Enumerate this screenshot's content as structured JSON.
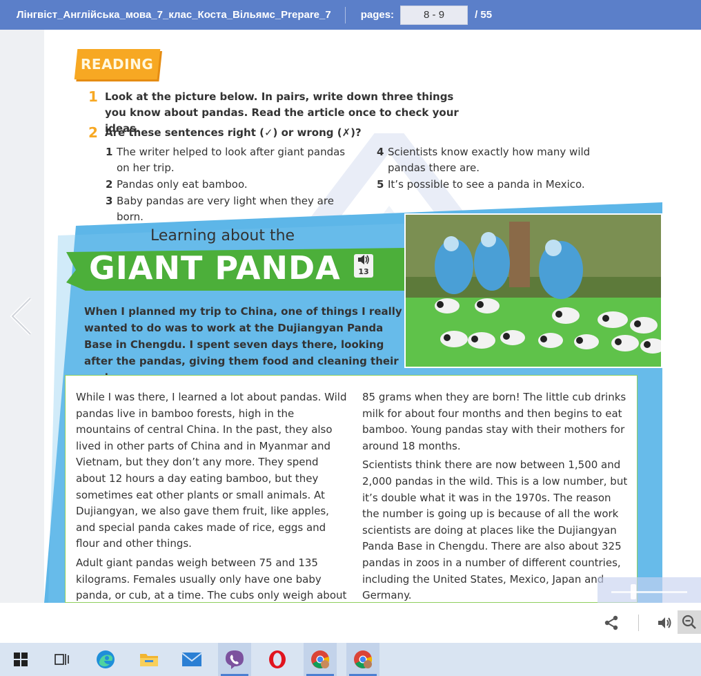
{
  "topbar": {
    "title": "Лінгвіст_Англійська_мова_7_клас_Коста_Вільямс_Prepare_7",
    "pages_label": "pages:",
    "pages_value": "8 - 9",
    "pages_total": "/ 55"
  },
  "page": {
    "section_tag": "READING",
    "task1": {
      "number": "1",
      "text": "Look at the picture below. In pairs, write down three things you know about pandas. Read the article once to check your ideas."
    },
    "task2": {
      "number": "2",
      "text": "Are these sentences right (✓) or wrong (✗)?"
    },
    "statements": [
      {
        "n": "1",
        "text": "The writer helped to look after giant pandas on her trip."
      },
      {
        "n": "2",
        "text": "Pandas only eat bamboo."
      },
      {
        "n": "3",
        "text": "Baby pandas are very light when they are born."
      },
      {
        "n": "4",
        "text": "Scientists know exactly how many wild pandas there are."
      },
      {
        "n": "5",
        "text": "It’s possible to see a panda in Mexico."
      }
    ],
    "article": {
      "headline_small": "Learning about the",
      "headline_big": "GIANT PANDA",
      "audio_track": "13",
      "intro": "When I planned my trip to China, one of things I really wanted to do was to work at the Dujiangyan Panda Base in Chengdu. I spent seven days there, looking after the pandas, giving them food and cleaning their enclosures.",
      "col1_p1": "While I was there, I learned a lot about pandas. Wild pandas live in bamboo forests, high in the mountains of central China. In the past, they also lived in other parts of China and in Myanmar and Vietnam, but they don’t any more. They spend about 12 hours a day eating bamboo, but they sometimes eat other plants or small animals. At Dujiangyan, we also gave them fruit, like apples, and special panda cakes made of rice, eggs and flour and other things.",
      "col1_p2": "Adult giant pandas weigh between 75 and 135 kilograms. Females usually only have one baby panda, or cub, at a time. The cubs only weigh about",
      "col2_p1": "85 grams when they are born! The little cub drinks milk for about four months and then begins to eat bamboo. Young pandas stay with their mothers for around 18 months.",
      "col2_p2": "Scientists think there are now between 1,500 and 2,000 pandas in the wild. This is a low number, but it’s double what it was in the 1970s. The reason the number is going up is because of all the work scientists are doing at places like the Dujiangyan Panda Base in Chengdu. There are also about 325 pandas in zoos in a number of different countries, including the United States, Mexico, Japan and Germany."
    }
  },
  "toolbar": {
    "icons": [
      "share-icon",
      "volume-icon",
      "zoom-out-icon"
    ]
  },
  "taskbar": {
    "apps": [
      "windows-start",
      "task-view",
      "edge",
      "file-explorer",
      "mail",
      "viber",
      "opera",
      "chrome",
      "chrome"
    ]
  },
  "colors": {
    "topbar": "#5b7fc9",
    "reading_orange": "#f7a823",
    "banner_green": "#4caf3a",
    "band_blue": "#5db6e8"
  }
}
